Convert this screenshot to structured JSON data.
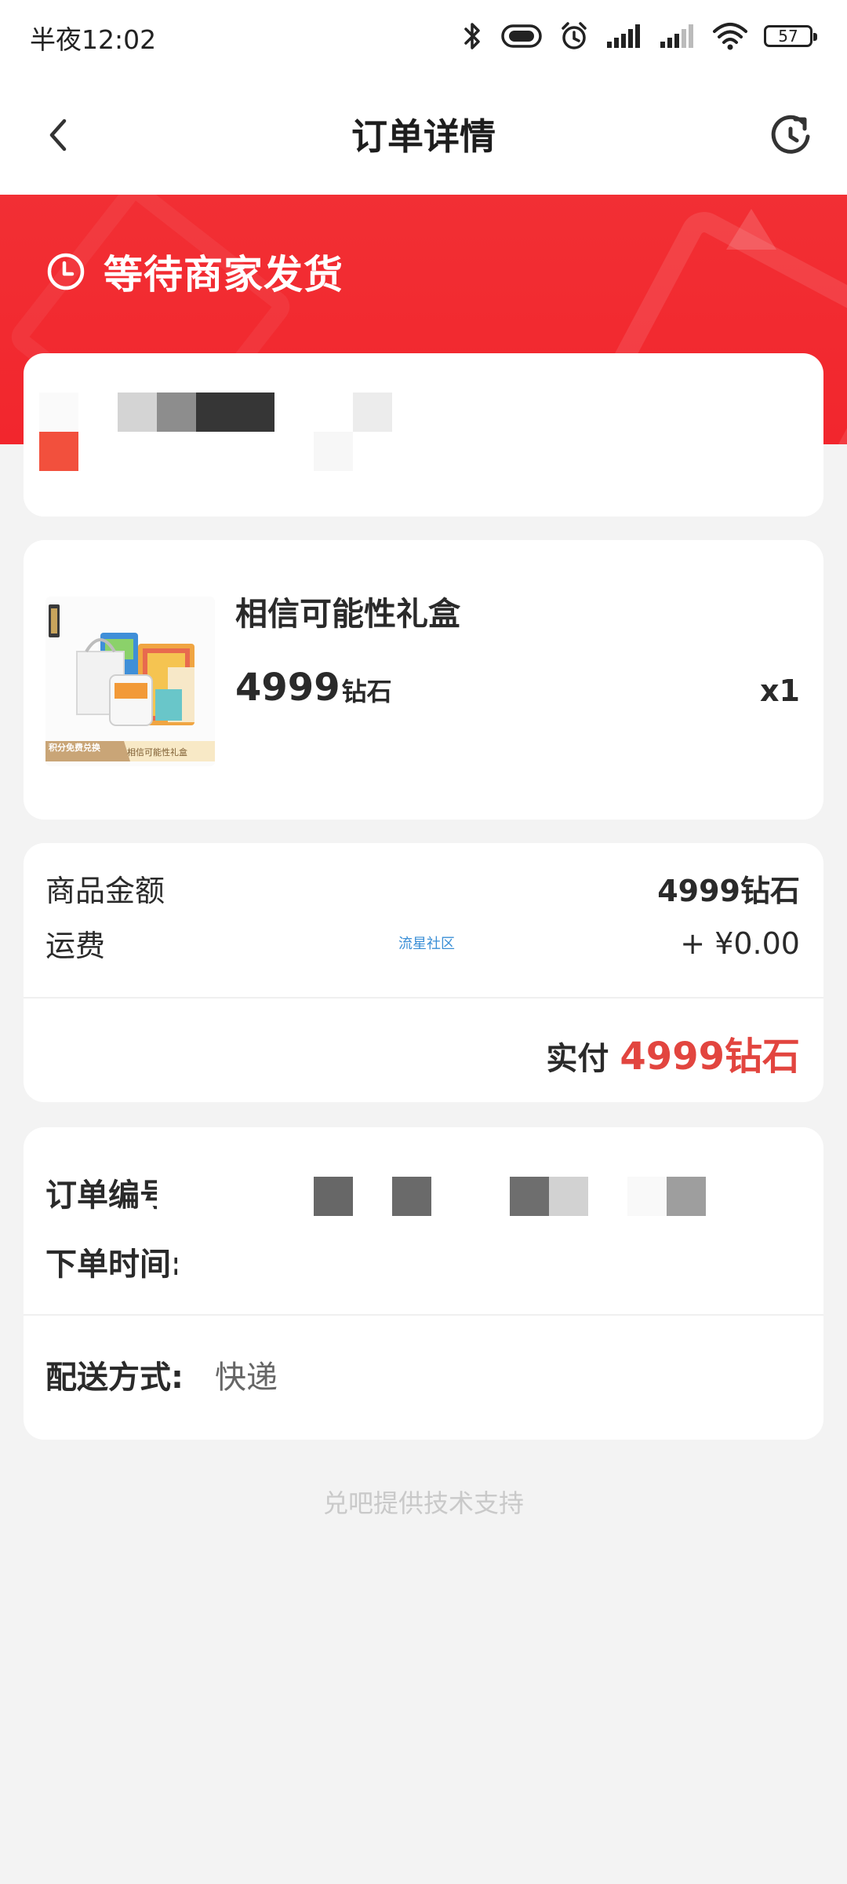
{
  "status_bar": {
    "time": "半夜12:02",
    "battery": "57",
    "icons": [
      "bluetooth-icon",
      "vibrate-icon",
      "alarm-icon",
      "signal-icon",
      "signal-icon",
      "wifi-icon",
      "battery-icon"
    ]
  },
  "nav": {
    "title": "订单详情",
    "back_icon": "chevron-left-icon",
    "refresh_icon": "refresh-icon"
  },
  "order_status": {
    "text": "等待商家发货",
    "icon": "clock-icon"
  },
  "product": {
    "name": "相信可能性礼盒",
    "price": "4999",
    "price_unit": "钻石",
    "quantity": "x1",
    "thumbnail_caption_left": "积分免费兑换",
    "thumbnail_caption_right": "相信可能性礼盒"
  },
  "amounts": {
    "goods_label": "商品金额",
    "goods_value": "4999钻石",
    "shipping_label": "运费",
    "shipping_value": "+ ¥0.00",
    "watermark": "流星社区",
    "paid_label": "实付",
    "paid_value": "4999钻石"
  },
  "order_info": {
    "order_no_label": "订单编号",
    "order_time_label": "下单时间:",
    "delivery_label": "配送方式:",
    "delivery_value": "快递"
  },
  "footer": {
    "text": "兑吧提供技术支持"
  },
  "colors": {
    "accent_red": "#f22f34",
    "price_red": "#e2453f",
    "background": "#f3f3f3"
  }
}
